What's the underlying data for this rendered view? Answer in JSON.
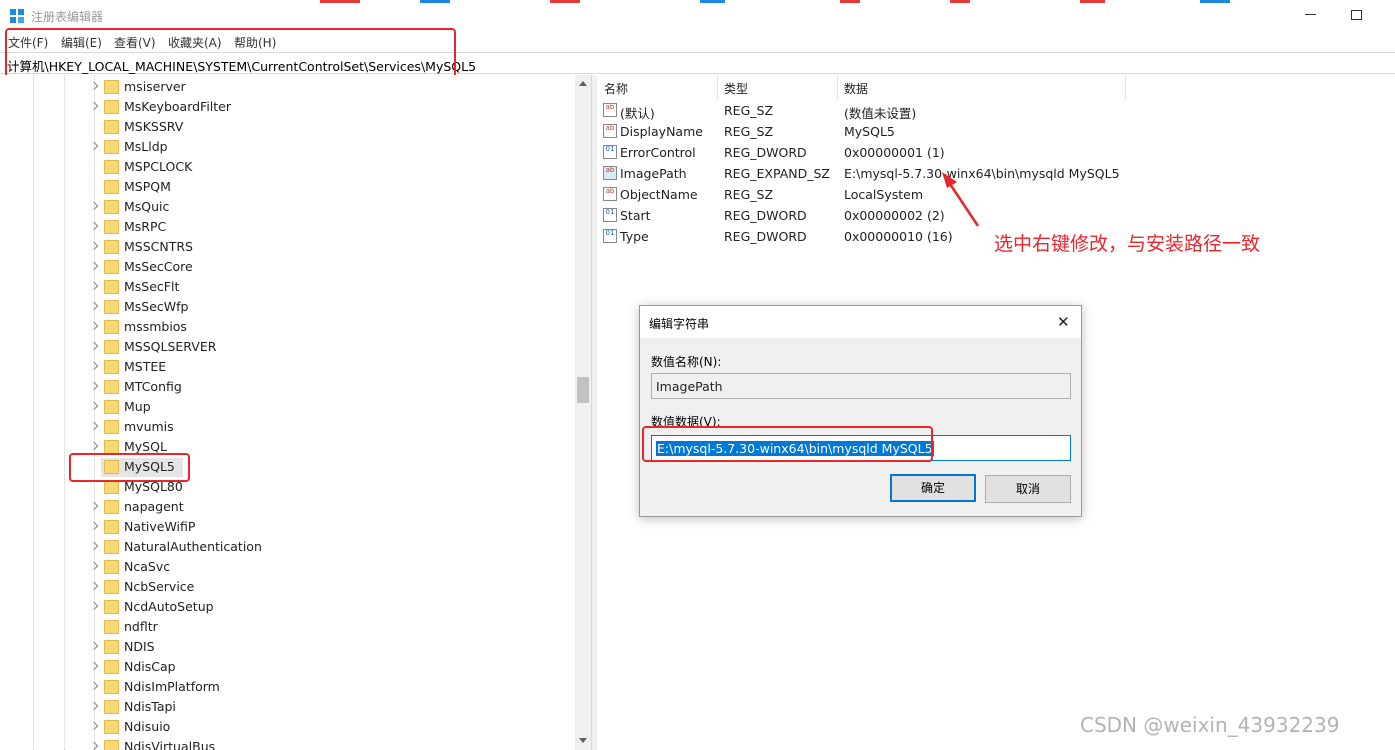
{
  "window": {
    "title": "注册表编辑器"
  },
  "menu": [
    "文件(F)",
    "编辑(E)",
    "查看(V)",
    "收藏夹(A)",
    "帮助(H)"
  ],
  "address": "计算机\\HKEY_LOCAL_MACHINE\\SYSTEM\\CurrentControlSet\\Services\\MySQL5",
  "tree": {
    "items": [
      "msiserver",
      "MsKeyboardFilter",
      "MSKSSRV",
      "MsLldp",
      "MSPCLOCK",
      "MSPQM",
      "MsQuic",
      "MsRPC",
      "MSSCNTRS",
      "MsSecCore",
      "MsSecFlt",
      "MsSecWfp",
      "mssmbios",
      "MSSQLSERVER",
      "MSTEE",
      "MTConfig",
      "Mup",
      "mvumis",
      "MySQL",
      "MySQL5",
      "MySQL80",
      "napagent",
      "NativeWifiP",
      "NaturalAuthentication",
      "NcaSvc",
      "NcbService",
      "NcdAutoSetup",
      "ndfltr",
      "NDIS",
      "NdisCap",
      "NdisImPlatform",
      "NdisTapi",
      "Ndisuio",
      "NdisVirtualBus"
    ],
    "selected": "MySQL5"
  },
  "values": {
    "headers": {
      "name": "名称",
      "type": "类型",
      "data": "数据"
    },
    "rows": [
      {
        "icon": "string-value-icon",
        "name": "(默认)",
        "type": "REG_SZ",
        "data": "(数值未设置)"
      },
      {
        "icon": "string-value-icon",
        "name": "DisplayName",
        "type": "REG_SZ",
        "data": "MySQL5"
      },
      {
        "icon": "binary-value-icon",
        "name": "ErrorControl",
        "type": "REG_DWORD",
        "data": "0x00000001 (1)"
      },
      {
        "icon": "string-value-icon",
        "name": "ImagePath",
        "type": "REG_EXPAND_SZ",
        "data": "E:\\mysql-5.7.30-winx64\\bin\\mysqld MySQL5"
      },
      {
        "icon": "string-value-icon",
        "name": "ObjectName",
        "type": "REG_SZ",
        "data": "LocalSystem"
      },
      {
        "icon": "binary-value-icon",
        "name": "Start",
        "type": "REG_DWORD",
        "data": "0x00000002 (2)"
      },
      {
        "icon": "binary-value-icon",
        "name": "Type",
        "type": "REG_DWORD",
        "data": "0x00000010 (16)"
      }
    ]
  },
  "annotation": {
    "text": "选中右键修改，与安装路径一致",
    "color": "#e8262b"
  },
  "dialog": {
    "title": "编辑字符串",
    "name_label": "数值名称(N):",
    "name_value": "ImagePath",
    "data_label": "数值数据(V):",
    "data_value": "E:\\mysql-5.7.30-winx64\\bin\\mysqld MySQL5",
    "ok": "确定",
    "cancel": "取消",
    "close_glyph": "✕"
  },
  "watermark": "CSDN @weixin_43932239",
  "colors": {
    "accent": "#0078d7",
    "folder": "#f8d775",
    "annotation": "#e8262b"
  }
}
